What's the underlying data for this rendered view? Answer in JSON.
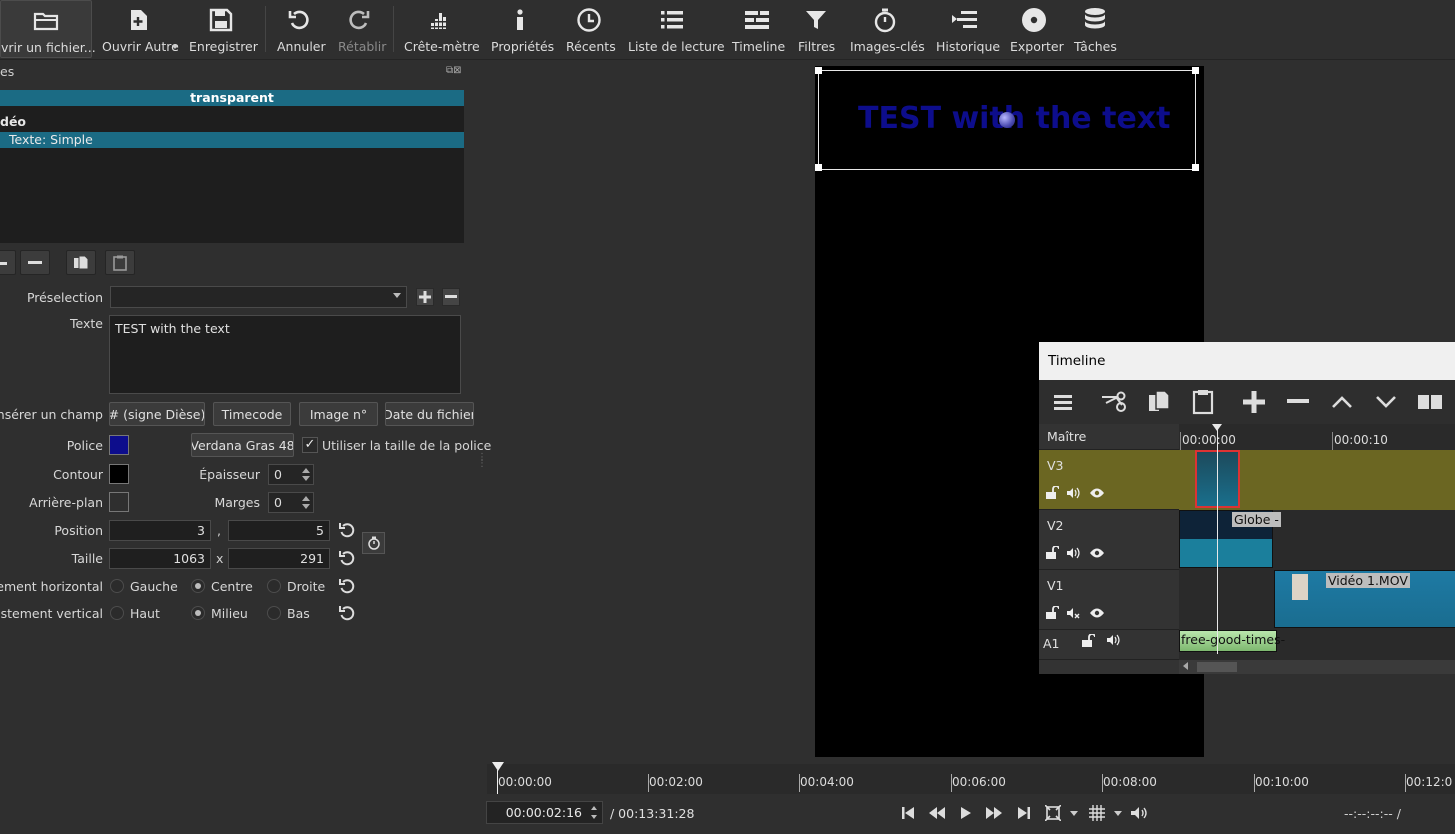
{
  "toolbar": {
    "open_file": "vrir un fichier...",
    "open_other": "Ouvrir Autre",
    "save": "Enregistrer",
    "undo": "Annuler",
    "redo": "Rétablir",
    "peak_meter": "Crête-mètre",
    "properties": "Propriétés",
    "recent": "Récents",
    "playlist": "Liste de lecture",
    "timeline": "Timeline",
    "filters": "Filtres",
    "keyframes": "Images-clés",
    "history": "Historique",
    "export": "Exporter",
    "jobs": "Tâches"
  },
  "filters_panel": {
    "title": "es",
    "clip_name": "transparent",
    "group": "déo",
    "selected_filter": "Texte: Simple"
  },
  "text_filter": {
    "preset_label": "Préselection",
    "preset_value": "",
    "text_label": "Texte",
    "text_value": "TEST with the text",
    "insert_field_label": "Insérer un champ",
    "insert_buttons": [
      "# (signe Dièse)",
      "Timecode",
      "Image n°",
      "Date du fichier"
    ],
    "font_label": "Police",
    "font_color": "#0d0d8c",
    "font_button": "Verdana Gras 48",
    "use_font_size_label": "Utiliser la taille de la police",
    "use_font_size_checked": true,
    "outline_label": "Contour",
    "outline_color": "#000000",
    "thickness_label": "Épaisseur",
    "thickness_value": "0",
    "background_label": "Arrière-plan",
    "background_color": "#2f2f2f",
    "margins_label": "Marges",
    "margins_value": "0",
    "position_label": "Position",
    "position_x": "3",
    "position_sep": ",",
    "position_y": "5",
    "size_label": "Taille",
    "size_w": "1063",
    "size_sep": "x",
    "size_h": "291",
    "halign_label": "stement horizontal",
    "halign_options": [
      "Gauche",
      "Centre",
      "Droite"
    ],
    "halign_selected": "Centre",
    "valign_label": "ijustement vertical",
    "valign_options": [
      "Haut",
      "Milieu",
      "Bas"
    ],
    "valign_selected": "Milieu"
  },
  "preview": {
    "overlay_text": "TEST with the text"
  },
  "timeline": {
    "title": "Timeline",
    "master_label": "Maître",
    "ruler": [
      "00:00:00",
      "00:00:10"
    ],
    "tracks": [
      {
        "name": "V3"
      },
      {
        "name": "V2",
        "clip": "Globe -"
      },
      {
        "name": "V1",
        "clip": "Vidéo 1.MOV"
      },
      {
        "name": "A1",
        "clip": "free-good-times-"
      }
    ]
  },
  "transport": {
    "ruler": [
      "00:00:00",
      "00:02:00",
      "00:04:00",
      "00:06:00",
      "00:08:00",
      "00:10:00",
      "00:12:0"
    ],
    "current": "00:00:02:16",
    "total": "/ 00:13:31:28",
    "in_out": "--:--:--:-- /"
  }
}
